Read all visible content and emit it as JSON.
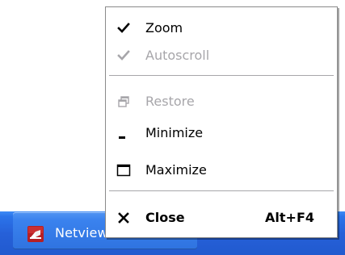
{
  "menu": {
    "items": [
      {
        "label": "Zoom",
        "icon": "checkmark-icon",
        "enabled": true,
        "checked": true
      },
      {
        "label": "Autoscroll",
        "icon": "checkmark-icon",
        "enabled": false,
        "checked": true
      },
      {
        "label": "Restore",
        "icon": "restore-window-icon",
        "enabled": false
      },
      {
        "label": "Minimize",
        "icon": "minimize-icon",
        "enabled": true
      },
      {
        "label": "Maximize",
        "icon": "maximize-icon",
        "enabled": true
      },
      {
        "label": "Close",
        "icon": "close-icon",
        "enabled": true,
        "shortcut": "Alt+F4",
        "bold": true
      }
    ]
  },
  "taskbar": {
    "button": {
      "label": "Netviewer",
      "icon": "netviewer-app-icon"
    }
  },
  "colors": {
    "taskbar": "#245edb",
    "menu_background": "#ffffff",
    "disabled_text": "#a7a6aa",
    "app_icon": "#b22222"
  }
}
